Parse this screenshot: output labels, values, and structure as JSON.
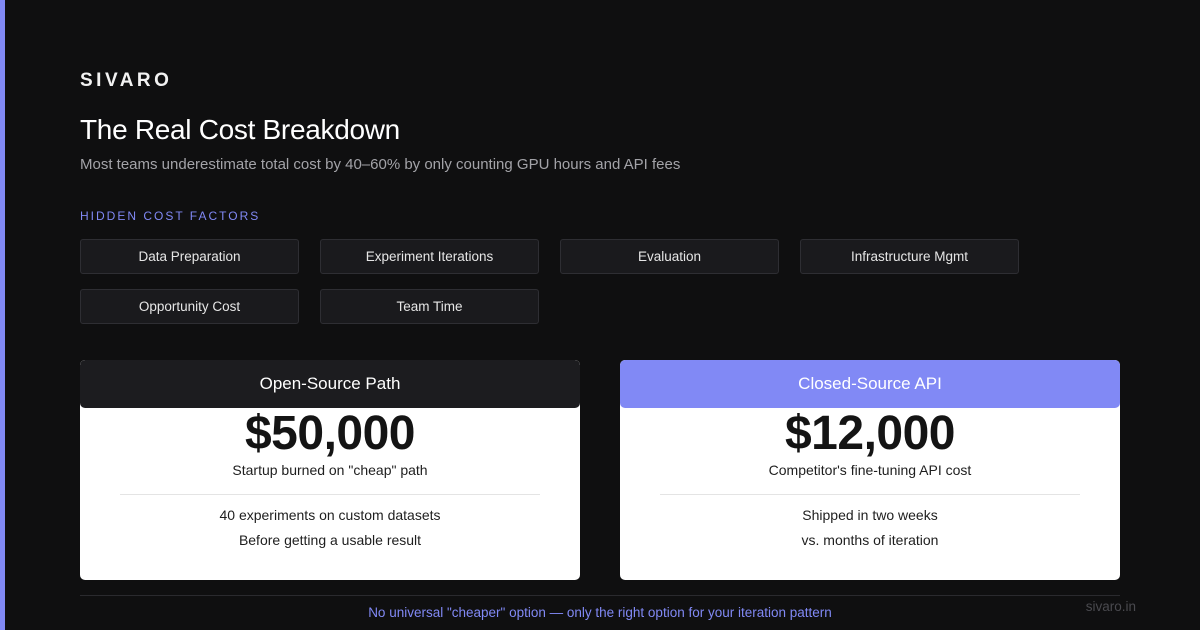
{
  "brand": "SIVARO",
  "title": "The Real Cost Breakdown",
  "subtitle": "Most teams underestimate total cost by 40–60% by only counting GPU hours and API fees",
  "hidden_factors": {
    "label": "HIDDEN COST FACTORS",
    "items": [
      "Data Preparation",
      "Experiment Iterations",
      "Evaluation",
      "Infrastructure Mgmt",
      "Opportunity Cost",
      "Team Time"
    ]
  },
  "cards": {
    "open_source": {
      "header": "Open-Source Path",
      "price": "$50,000",
      "caption": "Startup burned on \"cheap\" path",
      "detail_1": "40 experiments on custom datasets",
      "detail_2": "Before getting a usable result"
    },
    "closed_source": {
      "header": "Closed-Source API",
      "price": "$12,000",
      "caption": "Competitor's fine-tuning API cost",
      "detail_1": "Shipped in two weeks",
      "detail_2": "vs. months of iteration"
    }
  },
  "footer": {
    "note": "No universal \"cheaper\" option — only the right option for your iteration pattern",
    "domain": "sivaro.in"
  },
  "colors": {
    "accent": "#8189f5",
    "background": "#0f0f10",
    "chip_background": "#1a1a1d"
  }
}
